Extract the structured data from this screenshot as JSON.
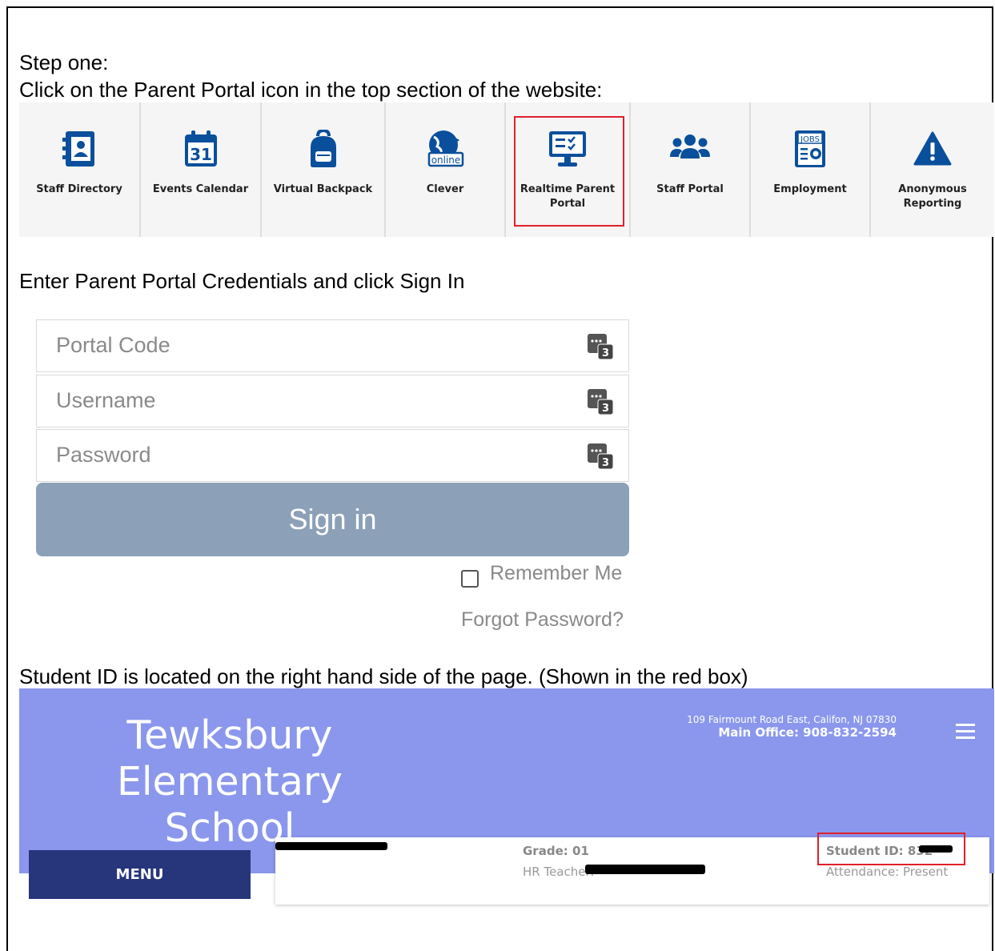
{
  "instructions": {
    "step_one": "Step one:",
    "step_one_detail": "Click on the Parent Portal icon in the top section of the website:",
    "credentials": "Enter Parent Portal Credentials and click Sign In",
    "student_id_note": "Student ID is located on the right hand side of the page. (Shown in the red box)"
  },
  "quick_links": [
    {
      "label": "Staff Directory",
      "icon": "contact-book-icon"
    },
    {
      "label": "Events Calendar",
      "icon": "calendar-icon",
      "icon_text": "31"
    },
    {
      "label": "Virtual Backpack",
      "icon": "backpack-icon"
    },
    {
      "label": "Clever",
      "icon": "online-globe-icon",
      "icon_text": "online"
    },
    {
      "label": "Realtime Parent Portal",
      "icon": "monitor-checklist-icon",
      "highlighted": true
    },
    {
      "label": "Staff Portal",
      "icon": "group-users-icon"
    },
    {
      "label": "Employment",
      "icon": "jobs-icon",
      "icon_text": "JOBS"
    },
    {
      "label": "Anonymous Reporting",
      "icon": "warning-triangle-icon"
    }
  ],
  "login": {
    "portal_code_placeholder": "Portal Code",
    "username_placeholder": "Username",
    "password_placeholder": "Password",
    "keyboard_icon_digit": "3",
    "sign_in": "Sign in",
    "remember_me": "Remember Me",
    "forgot_password": "Forgot Password?"
  },
  "school": {
    "name_line1": "Tewksbury",
    "name_line2": "Elementary School",
    "address": "109 Fairmount Road East, Califon, NJ 07830",
    "phone": "Main Office: 908-832-2594",
    "menu": "MENU"
  },
  "student_card": {
    "grade": "Grade: 01",
    "hr_teacher": "HR Teacher:",
    "student_id": "Student ID: 832",
    "attendance": "Attendance: Present"
  },
  "colors": {
    "highlight": "#e0202a",
    "icon_blue": "#0a4f9c",
    "school_header": "#8a97ec",
    "menu_button": "#27357b",
    "sign_in_button": "#8ca0b8"
  }
}
